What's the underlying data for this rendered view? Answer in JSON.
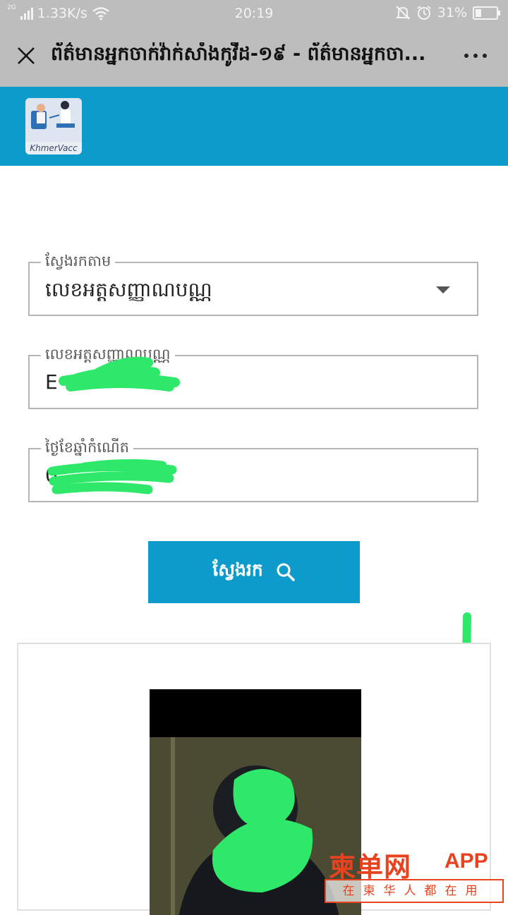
{
  "status_bar": {
    "network_type": "2G",
    "speed": "1.33K/s",
    "time": "20:19",
    "battery": "31%",
    "battery_level": 0.31
  },
  "title_bar": {
    "title": "ព័ត៌មានអ្នកចាក់វ៉ាក់សាំងកូវីដ-១៩ - ព័ត៌មានអ្នកចា..."
  },
  "header": {
    "logo_text": "KhmerVacc",
    "color": "#0d9bcb"
  },
  "form": {
    "search_by": {
      "label": "ស្វែងរកតាម",
      "value": "លេខអត្តសញ្ញាណបណ្ណ"
    },
    "id_number": {
      "label": "លេខអត្តសញ្ញាណបណ្ណ",
      "value": "E"
    },
    "dob": {
      "label": "ថ្ងៃខែឆ្នាំកំណើត",
      "value": "0"
    },
    "search_button": "ស្វែងរក"
  },
  "watermark": {
    "brand": "柬单网",
    "app": "APP",
    "tagline": "在柬华人都在用"
  },
  "colors": {
    "accent": "#0d9bcb",
    "scribble": "#2ee86a",
    "watermark": "#e8421f"
  }
}
